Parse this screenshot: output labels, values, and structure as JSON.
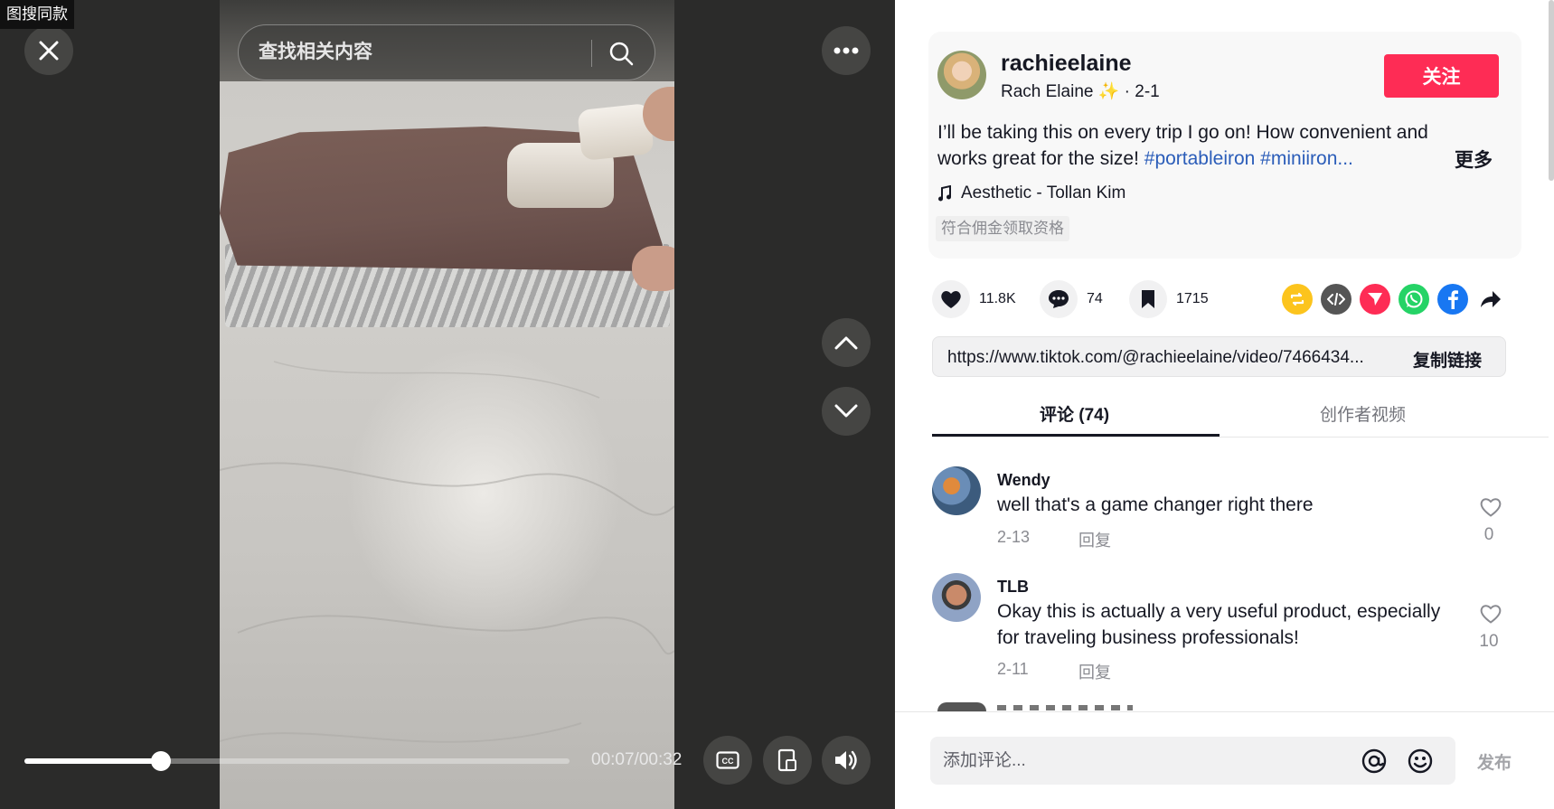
{
  "corner_label": "图搜同款",
  "search": {
    "placeholder": "查找相关内容"
  },
  "player": {
    "time": "00:07/00:32",
    "progress": 0.25
  },
  "author": {
    "username": "rachieelaine",
    "display_name": "Rach Elaine ✨",
    "date": " · 2-1",
    "follow_label": "关注"
  },
  "description": {
    "text": "I’ll be taking this on every trip I go on! How convenient and works great for the size! ",
    "tags": "#portableiron #miniiron...",
    "more_label": "更多"
  },
  "music": "Aesthetic - Tollan Kim",
  "badge": "符合佣金领取资格",
  "stats": {
    "likes": "11.8K",
    "comments": "74",
    "saves": "1715"
  },
  "share": {
    "link": "https://www.tiktok.com/@rachieelaine/video/7466434...",
    "copy_label": "复制链接"
  },
  "tabs": {
    "comments": "评论 (74)",
    "creator": "创作者视频"
  },
  "comments": [
    {
      "name": "Wendy",
      "text": "well that's a game changer right there",
      "date": "2-13",
      "reply": "回复",
      "likes": "0"
    },
    {
      "name": "TLB",
      "text": "Okay this is actually a very useful product, especially for traveling business professionals!",
      "date": "2-11",
      "reply": "回复",
      "likes": "10"
    }
  ],
  "composer": {
    "placeholder": "添加评论...",
    "post_label": "发布"
  },
  "colors": {
    "accent": "#fe2c55",
    "hashtag": "#2b5db9"
  },
  "icons": [
    "close-icon",
    "search-icon",
    "more-icon",
    "chevron-up-icon",
    "chevron-down-icon",
    "cc-icon",
    "pip-icon",
    "volume-icon",
    "music-note-icon",
    "heart-icon",
    "comment-icon",
    "bookmark-icon",
    "repost-icon",
    "embed-icon",
    "send-icon",
    "whatsapp-icon",
    "facebook-icon",
    "share-arrow-icon",
    "at-icon",
    "emoji-icon"
  ]
}
